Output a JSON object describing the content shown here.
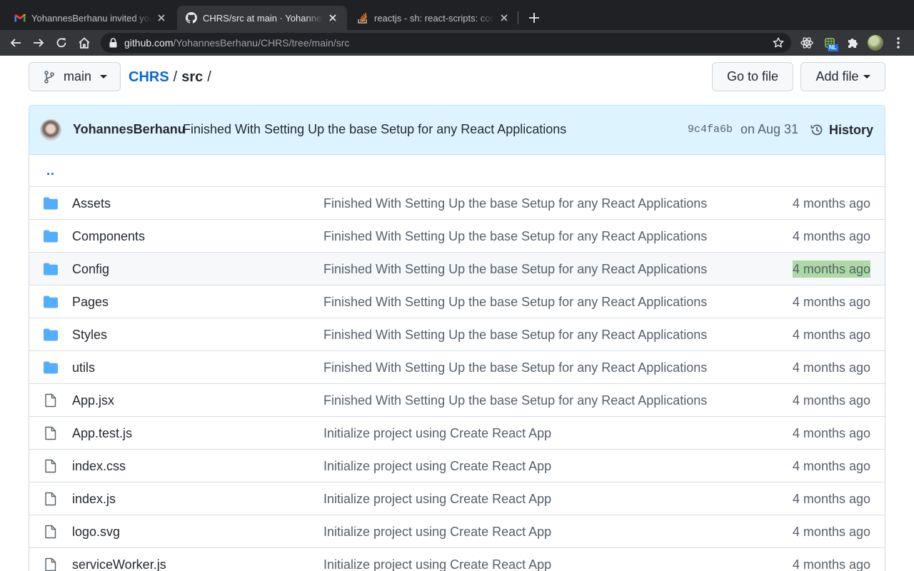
{
  "browser": {
    "tabs": [
      {
        "title": "YohannesBerhanu invited you t",
        "icon": "gmail-icon",
        "active": false
      },
      {
        "title": "CHRS/src at main · YohannesBerhanu",
        "icon": "github-icon",
        "active": true
      },
      {
        "title": "reactjs - sh: react-scripts: command not found",
        "icon": "stackoverflow-icon",
        "active": false
      }
    ],
    "url_host": "github.com",
    "url_path": "/YohannesBerhanu/CHRS/tree/main/src",
    "extension_badge": "NL",
    "toolbar_icons": [
      "back-icon",
      "forward-icon",
      "reload-icon",
      "home-icon",
      "lock-icon",
      "star-icon",
      "react-devtools-icon",
      "grid-extension-icon",
      "puzzle-icon",
      "profile-avatar",
      "menu-dots-icon"
    ]
  },
  "repo": {
    "branch": "main",
    "breadcrumb": {
      "repo": "CHRS",
      "separator": "/",
      "dir": "src",
      "trailing": "/"
    },
    "buttons": {
      "go_to_file": "Go to file",
      "add_file": "Add file"
    }
  },
  "commit": {
    "author": "YohannesBerhanu",
    "message": "Finished With Setting Up the base Setup for any React Applications",
    "sha": "9c4fa6b",
    "date": "on Aug 31",
    "history_label": "History"
  },
  "files": {
    "up_label": "..",
    "rows": [
      {
        "name": "Assets",
        "type": "dir",
        "message": "Finished With Setting Up the base Setup for any React Applications",
        "age": "4 months ago"
      },
      {
        "name": "Components",
        "type": "dir",
        "message": "Finished With Setting Up the base Setup for any React Applications",
        "age": "4 months ago"
      },
      {
        "name": "Config",
        "type": "dir",
        "message": "Finished With Setting Up the base Setup for any React Applications",
        "age": "4 months ago"
      },
      {
        "name": "Pages",
        "type": "dir",
        "message": "Finished With Setting Up the base Setup for any React Applications",
        "age": "4 months ago"
      },
      {
        "name": "Styles",
        "type": "dir",
        "message": "Finished With Setting Up the base Setup for any React Applications",
        "age": "4 months ago"
      },
      {
        "name": "utils",
        "type": "dir",
        "message": "Finished With Setting Up the base Setup for any React Applications",
        "age": "4 months ago"
      },
      {
        "name": "App.jsx",
        "type": "file",
        "message": "Finished With Setting Up the base Setup for any React Applications",
        "age": "4 months ago"
      },
      {
        "name": "App.test.js",
        "type": "file",
        "message": "Initialize project using Create React App",
        "age": "4 months ago"
      },
      {
        "name": "index.css",
        "type": "file",
        "message": "Initialize project using Create React App",
        "age": "4 months ago"
      },
      {
        "name": "index.js",
        "type": "file",
        "message": "Initialize project using Create React App",
        "age": "4 months ago"
      },
      {
        "name": "logo.svg",
        "type": "file",
        "message": "Initialize project using Create React App",
        "age": "4 months ago"
      },
      {
        "name": "serviceWorker.js",
        "type": "file",
        "message": "Initialize project using Create React App",
        "age": "4 months ago"
      }
    ]
  },
  "colors": {
    "link": "#0969da",
    "folder": "#54aeff",
    "commit_bg": "#ddf4ff",
    "selection": "#acd9a5"
  }
}
